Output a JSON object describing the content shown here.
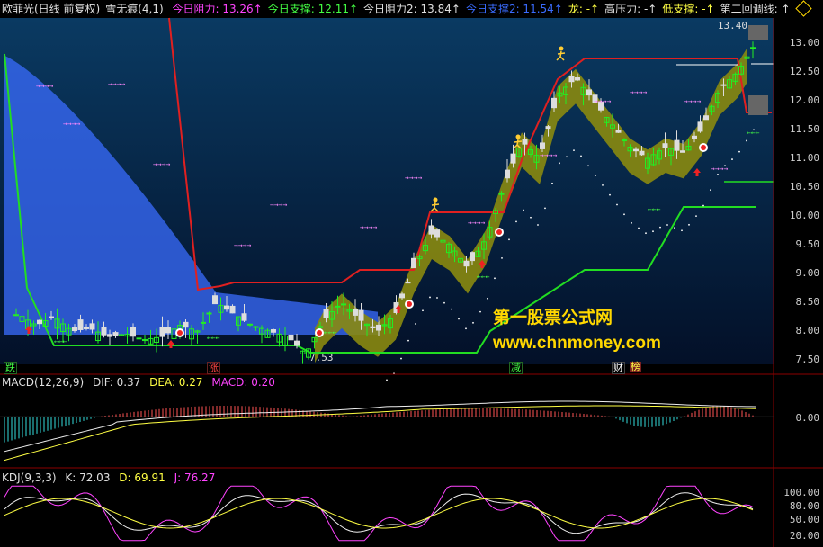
{
  "header": {
    "stock": "欧菲光(日线 前复权)",
    "indicator": "雪无痕(4,1)",
    "items": [
      {
        "label": "今日阻力:",
        "value": "13.26",
        "color": "#ff44ff"
      },
      {
        "label": "今日支撑:",
        "value": "12.11",
        "color": "#44ff44"
      },
      {
        "label": "今日阻力2:",
        "value": "13.84",
        "color": "#e0e0e0"
      },
      {
        "label": "今日支撑2:",
        "value": "11.54",
        "color": "#3a6cff"
      },
      {
        "label": "龙:",
        "value": "-",
        "color": "#ffff44"
      },
      {
        "label": "高压力:",
        "value": "-",
        "color": "#e0e0e0"
      },
      {
        "label": "低支撑:",
        "value": "-",
        "color": "#ffff44"
      },
      {
        "label": "第二回调线:",
        "value": "",
        "color": "#e0e0e0"
      }
    ]
  },
  "price_axis": [
    "13.00",
    "12.50",
    "12.00",
    "11.50",
    "11.00",
    "10.50",
    "10.00",
    "9.50",
    "9.00",
    "8.50",
    "8.00",
    "7.50"
  ],
  "annotations": {
    "high": "13.40",
    "low": "7.53"
  },
  "bottom_tags": [
    {
      "label": "跌",
      "color": "#44ff44"
    },
    {
      "label": "涨",
      "color": "#ff4444"
    },
    {
      "label": "减",
      "color": "#44ff44"
    },
    {
      "label": "财",
      "color": "#ffffff"
    },
    {
      "label": "榜",
      "color": "#ffff44"
    }
  ],
  "watermark": {
    "line1": "第一股票公式网",
    "line2": "www.chnmoney.com"
  },
  "macd": {
    "title": "MACD(12,26,9)",
    "dif": "DIF: 0.37",
    "dea": "DEA: 0.27",
    "macd": "MACD: 0.20",
    "axis": "0.00"
  },
  "kdj": {
    "title": "KDJ(9,3,3)",
    "k": "K: 72.03",
    "d": "D: 69.91",
    "j": "J: 76.27",
    "axis": [
      "100.00",
      "80.00",
      "50.00",
      "20.00"
    ]
  },
  "colors": {
    "up": "#ff3333",
    "down": "#00e0e0",
    "bull": "#22ee22",
    "bear": "#dddddd",
    "fill": "#8a8a10",
    "cloud": "#3a6cff"
  }
}
